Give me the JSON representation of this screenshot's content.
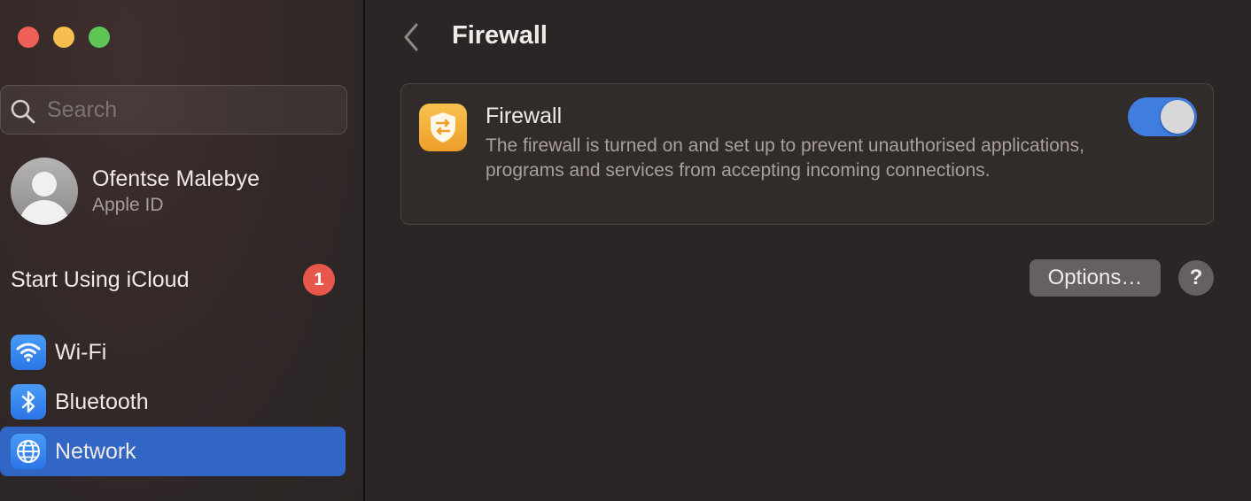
{
  "window": {
    "traffic_lights": [
      "close",
      "minimize",
      "zoom"
    ],
    "colors": {
      "close": "#ee5f58",
      "minimize": "#f5be4f",
      "zoom": "#5fc454",
      "accent": "#3166c4",
      "badge": "#e8574c"
    }
  },
  "sidebar": {
    "search": {
      "placeholder": "Search",
      "value": ""
    },
    "account": {
      "name": "Ofentse Malebye",
      "subtitle": "Apple ID"
    },
    "icloud": {
      "label": "Start Using iCloud",
      "badge": "1"
    },
    "items": [
      {
        "label": "Wi-Fi",
        "icon": "wifi-icon",
        "selected": false
      },
      {
        "label": "Bluetooth",
        "icon": "bluetooth-icon",
        "selected": false
      },
      {
        "label": "Network",
        "icon": "globe-icon",
        "selected": true
      }
    ]
  },
  "main": {
    "title": "Firewall",
    "card": {
      "title": "Firewall",
      "description": "The firewall is turned on and set up to prevent unauthorised applications, programs and services from accepting incoming connections.",
      "toggle_on": true
    },
    "options_label": "Options…",
    "help_label": "?"
  }
}
